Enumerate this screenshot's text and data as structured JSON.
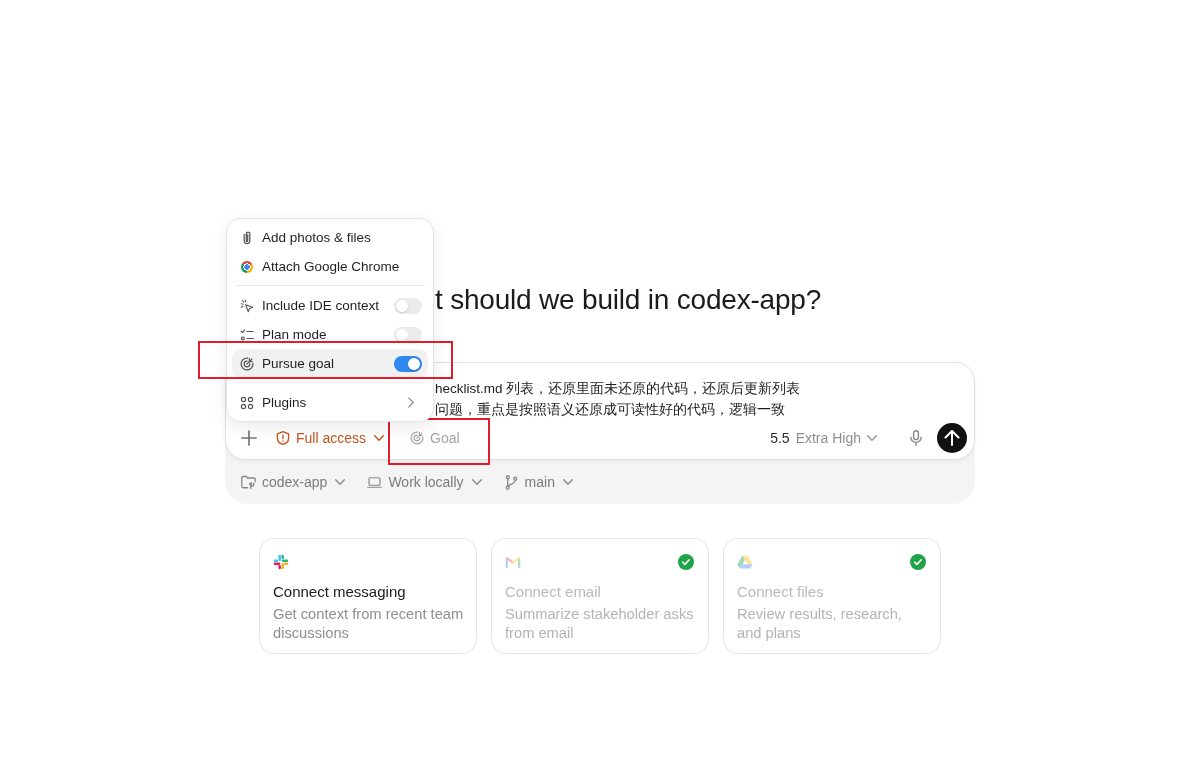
{
  "heading": "t should we build in codex-app?",
  "attach_menu": {
    "sections": [
      {
        "items": [
          {
            "kind": "action",
            "label": "Add photos & files",
            "selected": false,
            "annotated": false
          },
          {
            "kind": "action",
            "label": "Attach Google Chrome",
            "selected": false,
            "annotated": false
          }
        ]
      },
      {
        "items": [
          {
            "kind": "toggle",
            "label": "Include IDE context",
            "on": false,
            "selected": false,
            "annotated": false
          },
          {
            "kind": "toggle",
            "label": "Plan mode",
            "on": false,
            "selected": false,
            "annotated": false
          },
          {
            "kind": "toggle",
            "label": "Pursue goal",
            "on": true,
            "selected": true,
            "annotated": true
          }
        ]
      },
      {
        "items": [
          {
            "kind": "submenu",
            "label": "Plugins",
            "selected": false,
            "annotated": false
          }
        ]
      }
    ]
  },
  "composer": {
    "value_lines": [
      "hecklist.md 列表，还原里面未还原的代码，还原后更新列表",
      "问题，重点是按照语义还原成可读性好的代码，逻辑一致"
    ],
    "toolbar": {
      "access": {
        "label": "Full access"
      },
      "goal": {
        "label": "Goal",
        "annotated": true
      },
      "model": {
        "version": "5.5",
        "effort": "Extra High"
      }
    }
  },
  "context_bar": [
    {
      "label": "codex-app"
    },
    {
      "label": "Work locally"
    },
    {
      "label": "main"
    }
  ],
  "connectors": [
    {
      "title": "Connect messaging",
      "description": "Get context from recent team discussions",
      "connected": false
    },
    {
      "title": "Connect email",
      "description": "Summarize stakeholder asks from email",
      "connected": true
    },
    {
      "title": "Connect files",
      "description": "Review results, research, and plans",
      "connected": true
    }
  ]
}
